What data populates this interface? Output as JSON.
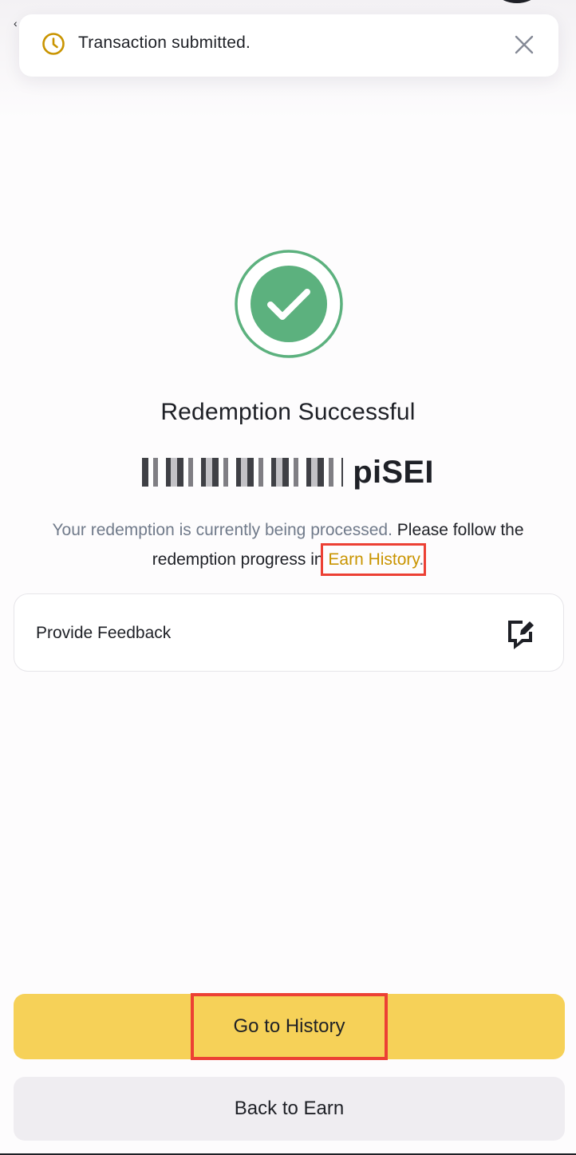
{
  "toast": {
    "message": "Transaction submitted.",
    "status_icon": "clock-icon",
    "close_icon": "close-icon",
    "accent_color": "#c99400"
  },
  "result": {
    "status_icon": "check-circle-icon",
    "status_color": "#5cb17e",
    "title": "Redemption Successful",
    "amount_unit": "piSEI"
  },
  "message": {
    "part1": "Your redemption is currently being processed.",
    "part2": "Please follow the redemption progress in",
    "link_label": "Earn History",
    "suffix": "."
  },
  "feedback": {
    "label": "Provide Feedback",
    "icon": "feedback-edit-icon"
  },
  "buttons": {
    "primary_label": "Go to History",
    "primary_color": "#f6d158",
    "secondary_label": "Back to Earn",
    "secondary_color": "#efedf1"
  }
}
